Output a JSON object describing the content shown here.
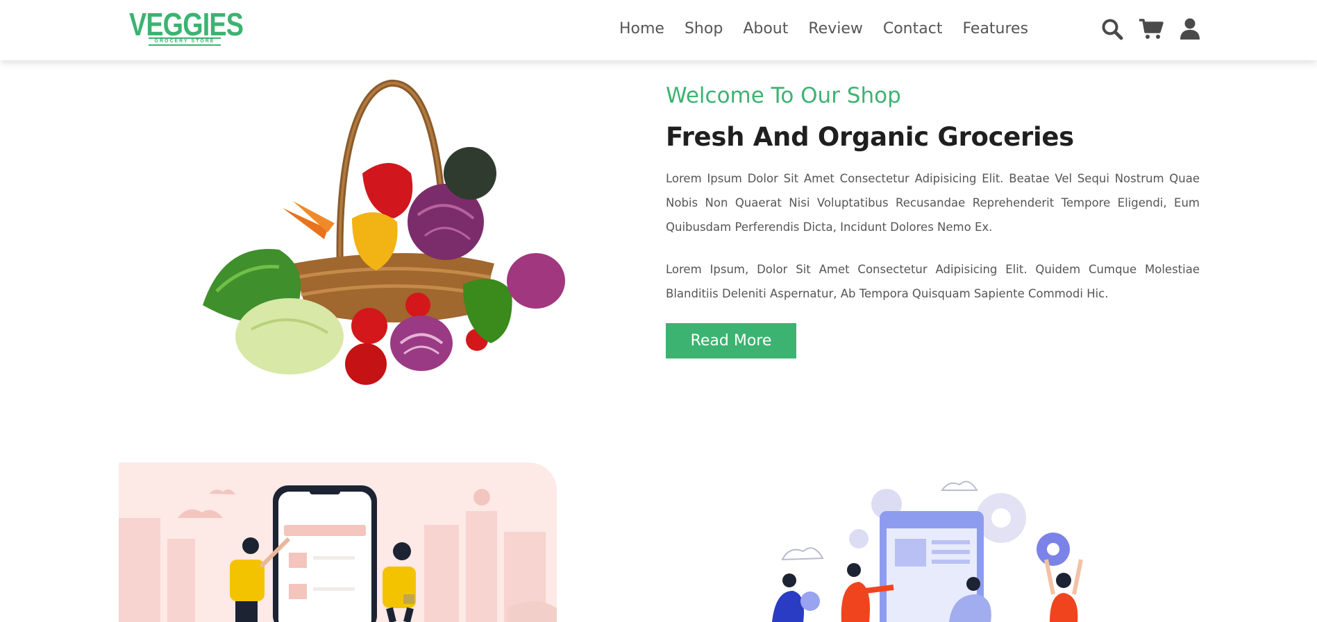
{
  "brand": {
    "name": "VEGGIES",
    "tagline": "GROCERY STORE",
    "color": "#3cb371"
  },
  "nav": {
    "items": [
      "Home",
      "Shop",
      "About",
      "Review",
      "Contact",
      "Features"
    ]
  },
  "header_icons": [
    "search-icon",
    "cart-icon",
    "user-icon"
  ],
  "hero": {
    "subtitle": "Welcome To Our Shop",
    "title": "Fresh And Organic Groceries",
    "paragraph1": "Lorem Ipsum Dolor Sit Amet Consectetur Adipisicing Elit. Beatae Vel Sequi Nostrum Quae Nobis Non Quaerat Nisi Voluptatibus Recusandae Reprehenderit Tempore Eligendi, Eum Quibusdam Perferendis Dicta, Incidunt Dolores Nemo Ex.",
    "paragraph2": "Lorem Ipsum, Dolor Sit Amet Consectetur Adipisicing Elit. Quidem Cumque Molestiae Blanditiis Deleniti Aspernatur, Ab Tempora Quisquam Sapiente Commodi Hic.",
    "button_label": "Read More"
  },
  "colors": {
    "accent": "#3cb371",
    "text_dark": "#1f1f1f",
    "text_body": "#555555"
  }
}
